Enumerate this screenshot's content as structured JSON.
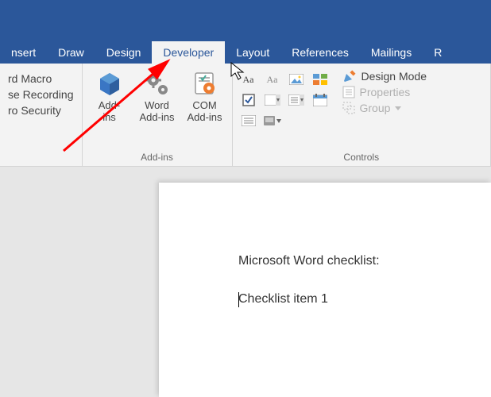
{
  "tabs": {
    "insert": "nsert",
    "draw": "Draw",
    "design": "Design",
    "developer": "Developer",
    "layout": "Layout",
    "references": "References",
    "mailings": "Mailings",
    "review": "R"
  },
  "code": {
    "macro": "rd Macro",
    "recording": "se Recording",
    "security": "ro Security"
  },
  "addins": {
    "addins_label": "Add-\nins",
    "word_addins_label": "Word\nAdd-ins",
    "com_addins_label": "COM\nAdd-ins",
    "group_label": "Add-ins"
  },
  "controls": {
    "design_mode": "Design Mode",
    "properties": "Properties",
    "group": "Group",
    "group_label": "Controls"
  },
  "document": {
    "line1": "Microsoft Word checklist:",
    "line2": "Checklist item 1"
  }
}
